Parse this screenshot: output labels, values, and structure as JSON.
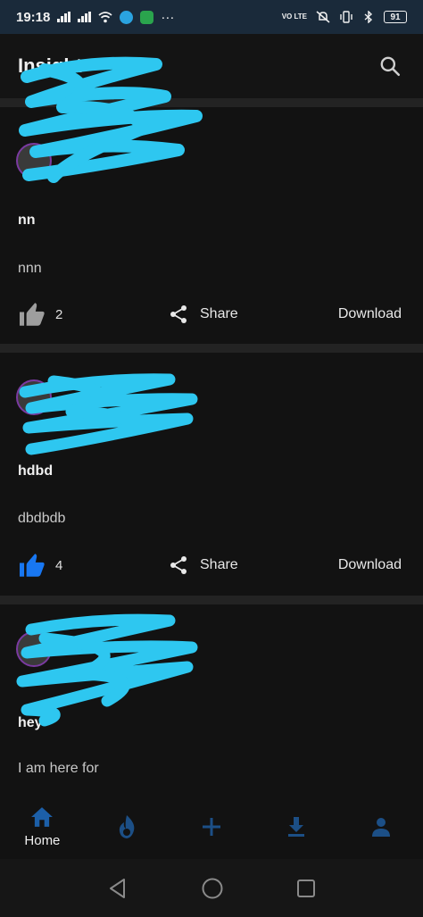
{
  "status_bar": {
    "time": "19:18",
    "signal_label": "4G",
    "more": "···",
    "volte": "VO LTE",
    "battery": "91"
  },
  "app_bar": {
    "title": "Insight",
    "search_icon": "search-icon"
  },
  "posts": [
    {
      "author": "",
      "title": "nn",
      "body": "nnn",
      "likes": "2",
      "liked": false,
      "share_label": "Share",
      "download_label": "Download"
    },
    {
      "author": "",
      "title": "hdbd",
      "body": "dbdbdb",
      "likes": "4",
      "liked": true,
      "share_label": "Share",
      "download_label": "Download"
    },
    {
      "author": "",
      "title": "hey",
      "body": "I am here for",
      "likes": "",
      "liked": false,
      "share_label": "Share",
      "download_label": "Download"
    }
  ],
  "bottom_nav": {
    "items": [
      {
        "label": "Home",
        "icon": "home-icon",
        "active": true
      },
      {
        "label": "",
        "icon": "flame-icon",
        "active": false
      },
      {
        "label": "",
        "icon": "plus-icon",
        "active": false
      },
      {
        "label": "",
        "icon": "download-icon",
        "active": false
      },
      {
        "label": "",
        "icon": "person-icon",
        "active": false
      }
    ]
  },
  "colors": {
    "accent": "#1877f2",
    "nav_inactive": "#1c4f86",
    "redaction": "#2ec7f0",
    "background": "#121212"
  }
}
